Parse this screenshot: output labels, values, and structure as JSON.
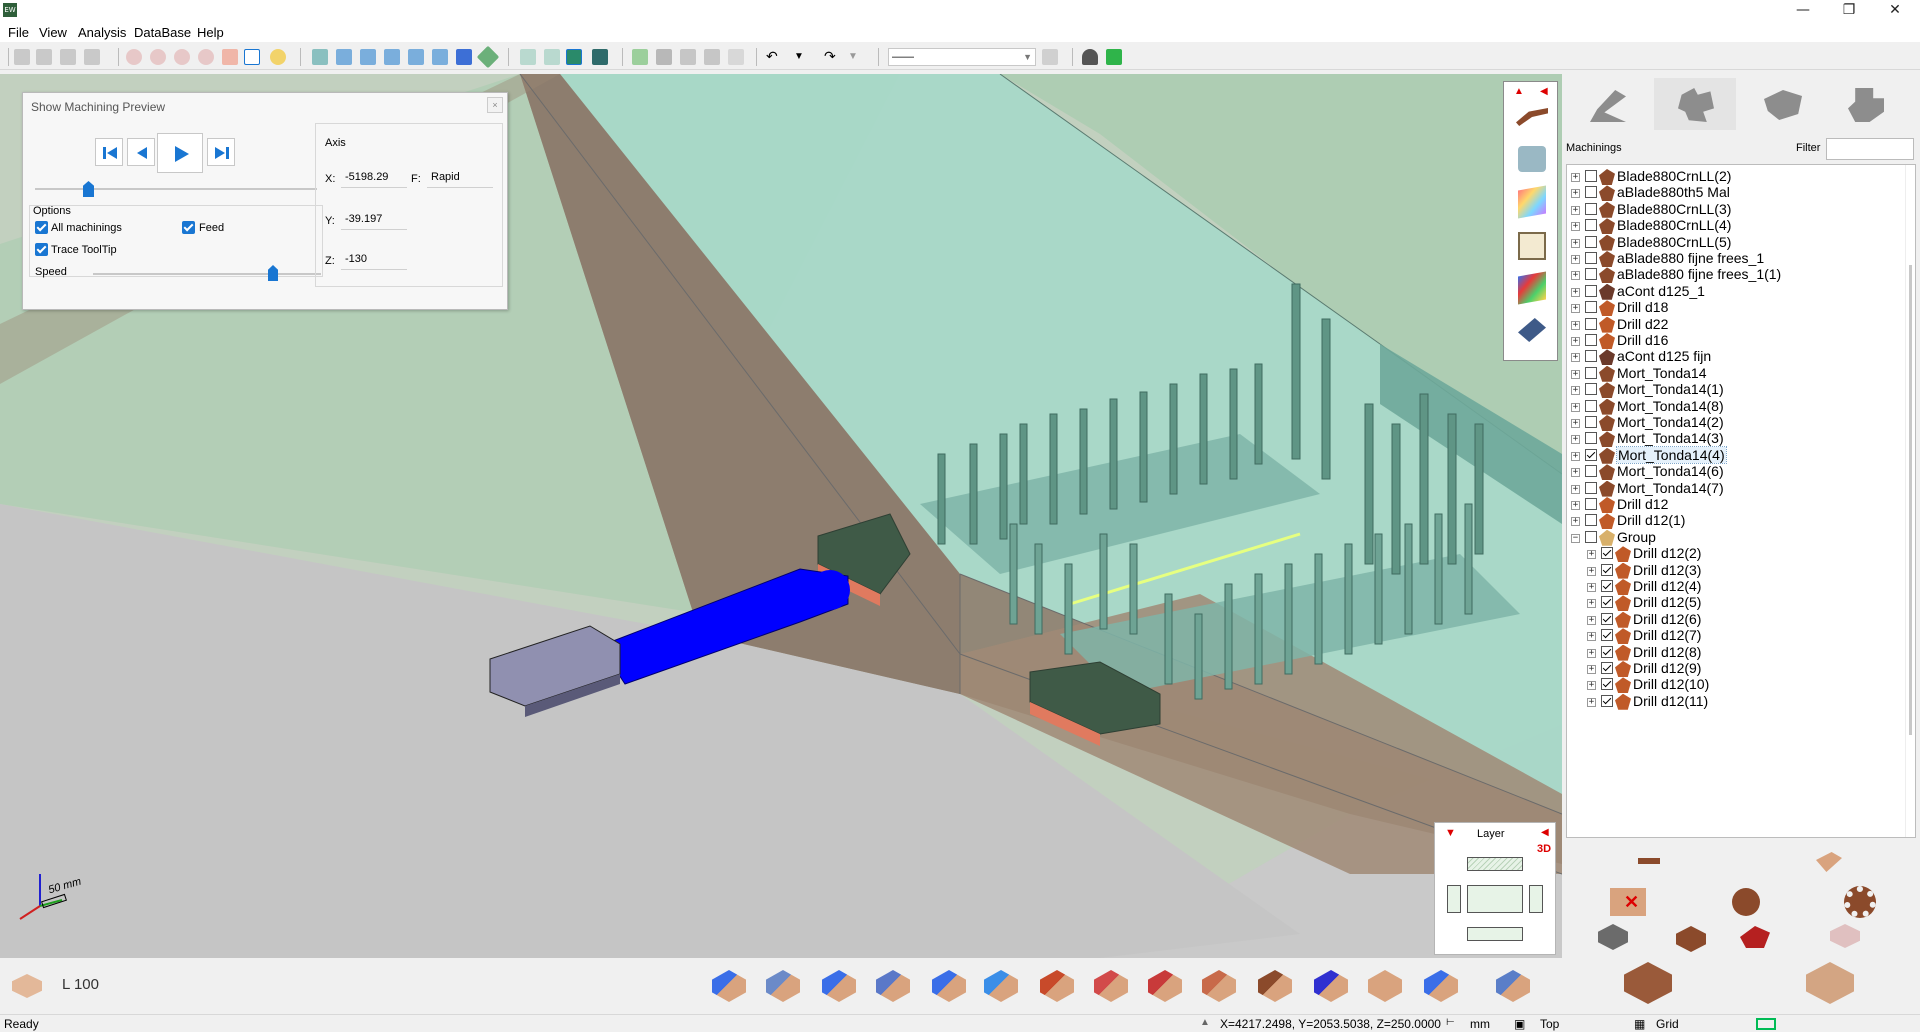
{
  "window": {
    "icon_text": "EW",
    "controls": {
      "minimize": "—",
      "maximize": "❐",
      "close": "✕"
    }
  },
  "menu": [
    "File",
    "View",
    "Analysis",
    "DataBase",
    "Help"
  ],
  "toolbar": {
    "layer_combo_value": "——"
  },
  "preview_dialog": {
    "title": "Show Machining Preview",
    "close": "×",
    "options_label": "Options",
    "all_machinings_label": "All machinings",
    "all_machinings_checked": true,
    "feed_label": "Feed",
    "feed_checked": true,
    "trace_tooltip_label": "Trace ToolTip",
    "trace_tooltip_checked": true,
    "speed_label": "Speed",
    "axis_label": "Axis",
    "x_label": "X:",
    "x_value": "-5198.29",
    "f_label": "F:",
    "f_value": "Rapid",
    "y_label": "Y:",
    "y_value": "-39.197",
    "z_label": "Z:",
    "z_value": "-130"
  },
  "viewport": {
    "axis_scale_label": "50 mm"
  },
  "layer_widget": {
    "title": "Layer",
    "mode": "3D"
  },
  "right_panel": {
    "machinings_label": "Machinings",
    "filter_label": "Filter",
    "filter_value": "",
    "tree": [
      {
        "label": "Blade880CrnLL(2)",
        "checked": false,
        "icon": "blade-icon",
        "indent": 0
      },
      {
        "label": "aBlade880th5 Mal",
        "checked": false,
        "icon": "blade-icon",
        "indent": 0
      },
      {
        "label": "Blade880CrnLL(3)",
        "checked": false,
        "icon": "blade-icon",
        "indent": 0
      },
      {
        "label": "Blade880CrnLL(4)",
        "checked": false,
        "icon": "blade-icon",
        "indent": 0
      },
      {
        "label": "Blade880CrnLL(5)",
        "checked": false,
        "icon": "blade-icon",
        "indent": 0
      },
      {
        "label": "aBlade880 fijne frees_1",
        "checked": false,
        "icon": "blade-icon",
        "indent": 0
      },
      {
        "label": "aBlade880 fijne frees_1(1)",
        "checked": false,
        "icon": "blade-icon",
        "indent": 0
      },
      {
        "label": "aCont d125_1",
        "checked": false,
        "icon": "contour-icon",
        "indent": 0
      },
      {
        "label": "Drill d18",
        "checked": false,
        "icon": "drill-icon",
        "indent": 0
      },
      {
        "label": "Drill d22",
        "checked": false,
        "icon": "drill-icon",
        "indent": 0
      },
      {
        "label": "Drill d16",
        "checked": false,
        "icon": "drill-icon",
        "indent": 0
      },
      {
        "label": "aCont d125 fijn",
        "checked": false,
        "icon": "contour-icon",
        "indent": 0
      },
      {
        "label": "Mort_Tonda14",
        "checked": false,
        "icon": "mortise-icon",
        "indent": 0
      },
      {
        "label": "Mort_Tonda14(1)",
        "checked": false,
        "icon": "mortise-icon",
        "indent": 0
      },
      {
        "label": "Mort_Tonda14(8)",
        "checked": false,
        "icon": "mortise-icon",
        "indent": 0
      },
      {
        "label": "Mort_Tonda14(2)",
        "checked": false,
        "icon": "mortise-icon",
        "indent": 0
      },
      {
        "label": "Mort_Tonda14(3)",
        "checked": false,
        "icon": "mortise-icon",
        "indent": 0
      },
      {
        "label": "Mort_Tonda14(4)",
        "checked": true,
        "icon": "mortise-icon",
        "indent": 0,
        "selected": true
      },
      {
        "label": "Mort_Tonda14(6)",
        "checked": false,
        "icon": "mortise-icon",
        "indent": 0
      },
      {
        "label": "Mort_Tonda14(7)",
        "checked": false,
        "icon": "mortise-icon",
        "indent": 0
      },
      {
        "label": "Drill d12",
        "checked": false,
        "icon": "drill-icon",
        "indent": 0
      },
      {
        "label": "Drill d12(1)",
        "checked": false,
        "icon": "drill-icon",
        "indent": 0
      },
      {
        "label": "Group",
        "checked": false,
        "icon": "group-icon",
        "indent": 0,
        "expanded": true
      },
      {
        "label": "Drill d12(2)",
        "checked": true,
        "icon": "drill-icon",
        "indent": 1
      },
      {
        "label": "Drill d12(3)",
        "checked": true,
        "icon": "drill-icon",
        "indent": 1
      },
      {
        "label": "Drill d12(4)",
        "checked": true,
        "icon": "drill-icon",
        "indent": 1
      },
      {
        "label": "Drill d12(5)",
        "checked": true,
        "icon": "drill-icon",
        "indent": 1
      },
      {
        "label": "Drill d12(6)",
        "checked": true,
        "icon": "drill-icon",
        "indent": 1
      },
      {
        "label": "Drill d12(7)",
        "checked": true,
        "icon": "drill-icon",
        "indent": 1
      },
      {
        "label": "Drill d12(8)",
        "checked": true,
        "icon": "drill-icon",
        "indent": 1
      },
      {
        "label": "Drill d12(9)",
        "checked": true,
        "icon": "drill-icon",
        "indent": 1
      },
      {
        "label": "Drill d12(10)",
        "checked": true,
        "icon": "drill-icon",
        "indent": 1
      },
      {
        "label": "Drill d12(11)",
        "checked": true,
        "icon": "drill-icon",
        "indent": 1
      }
    ]
  },
  "bottom_bar": {
    "length_label": "L 100",
    "machining_icons": [
      "drill-vertical-icon",
      "drill-multi-icon",
      "drill-horizontal-icon",
      "drill-down-icon",
      "drill-angled-icon",
      "saw-round-icon",
      "saw-blade-icon",
      "pocket-icon",
      "mortise-red-icon",
      "cut-icon",
      "macro-icon",
      "m-icon",
      "panel-icon",
      "drill-blue-icon",
      "saw-disc-icon"
    ]
  },
  "status": {
    "ready": "Ready",
    "coords": "X=4217.2498, Y=2053.5038, Z=250.0000",
    "unit": "mm",
    "view": "Top",
    "grid": "Grid"
  },
  "colors": {
    "accent": "#1976d2",
    "panel_green": "#a9d8c4",
    "tool_blue": "#0000ff",
    "wall_brown": "#9a8674"
  }
}
